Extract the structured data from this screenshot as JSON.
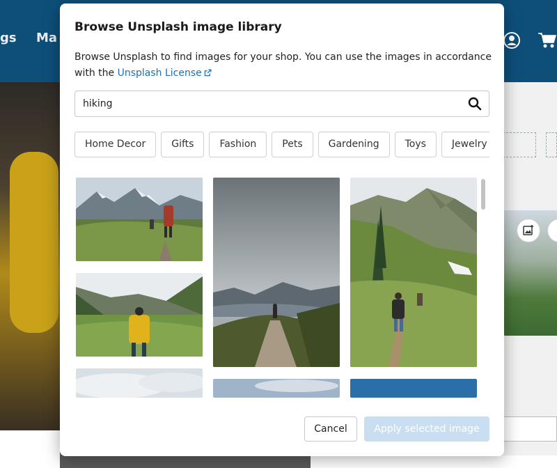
{
  "background": {
    "nav_items": [
      "gs",
      "Ma"
    ],
    "header_color": "#0e4f7a"
  },
  "modal": {
    "title": "Browse Unsplash image library",
    "description_prefix": "Browse Unsplash to find images for your shop. You can use the images in accordance with the ",
    "license_link": "Unsplash License",
    "search": {
      "value": "hiking",
      "placeholder": ""
    },
    "categories": [
      "Home Decor",
      "Gifts",
      "Fashion",
      "Pets",
      "Gardening",
      "Toys",
      "Jewelry"
    ],
    "footer": {
      "cancel_label": "Cancel",
      "apply_label": "Apply selected image"
    }
  },
  "colors": {
    "link": "#1f6fb2",
    "apply_disabled": "#c9def1"
  }
}
